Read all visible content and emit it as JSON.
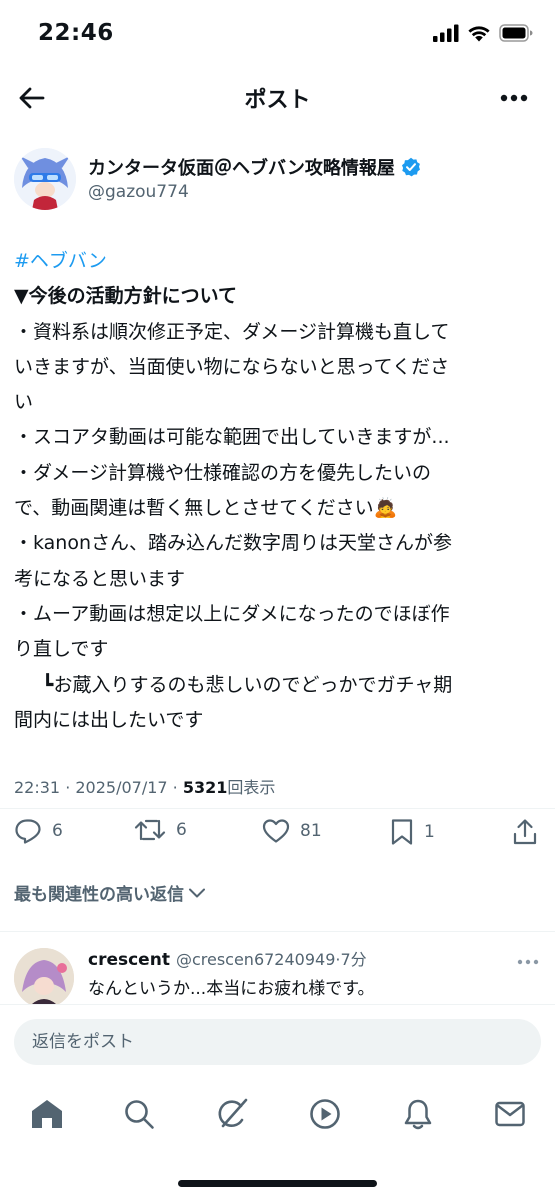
{
  "status_bar": {
    "time": "22:46"
  },
  "nav": {
    "title": "ポスト"
  },
  "author": {
    "name": "カンタータ仮面＠ヘブバン攻略情報屋",
    "handle": "@gazou774"
  },
  "post": {
    "lines": [
      "#ヘブバン",
      "▼今後の活動方針について",
      "・資料系は順次修正予定、ダメージ計算機も直して",
      "いきますが、当面使い物にならないと思ってくださ",
      "い",
      "・スコアタ動画は可能な範囲で出していきますが...",
      "・ダメージ計算機や仕様確認の方を優先したいの",
      "で、動画関連は暫く無しとさせてください🙇",
      "・kanonさん、踏み込んだ数字周りは天堂さんが参",
      "考になると思います",
      "・ムーア動画は想定以上にダメになったのでほぼ作",
      "り直しです",
      "┗お蔵入りするのも悲しいのでどっかでガチャ期",
      "間内には出したいです"
    ]
  },
  "meta": {
    "time_date": "22:31 · 2025/07/17 · ",
    "views_count": "5321",
    "views_label": "回表示"
  },
  "actions": {
    "replies": "6",
    "reposts": "6",
    "likes": "81",
    "bookmarks": "1"
  },
  "sort_label": "最も関連性の高い返信",
  "reply": {
    "name": "crescent",
    "handle": "@crescen67240949",
    "time": "·7分",
    "text": "なんというか...本当にお疲れ様です。"
  },
  "compose": {
    "placeholder": "返信をポスト"
  },
  "tabs": [
    "home-icon",
    "search-icon",
    "grok-icon",
    "video-icon",
    "notifications-icon",
    "messages-icon"
  ],
  "colors": {
    "accent": "#1d9bf0",
    "text": "#0f1419",
    "secondary": "#536471",
    "divider": "#eff3f4"
  }
}
